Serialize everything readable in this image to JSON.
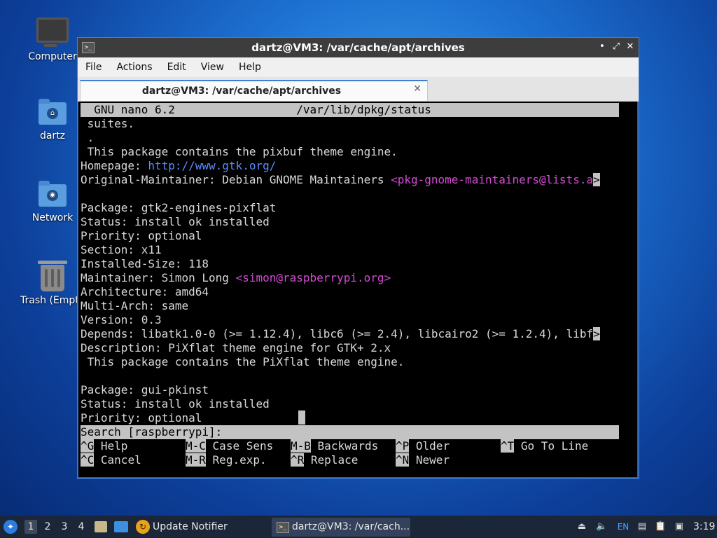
{
  "desktop": {
    "icons": [
      {
        "label": "Computer",
        "icon": "computer-icon"
      },
      {
        "label": "dartz",
        "icon": "home-folder-icon"
      },
      {
        "label": "Network",
        "icon": "network-folder-icon"
      },
      {
        "label": "Trash (Empt",
        "icon": "trash-icon"
      }
    ]
  },
  "window": {
    "title": "dartz@VM3: /var/cache/apt/archives",
    "controls": {
      "minimize": "•",
      "maximize": "⤢",
      "close": "✕"
    },
    "menu": [
      "File",
      "Actions",
      "Edit",
      "View",
      "Help"
    ],
    "tab": {
      "label": "dartz@VM3: /var/cache/apt/archives",
      "close": "✕"
    }
  },
  "nano": {
    "version": "GNU nano 6.2",
    "filename": "/var/lib/dpkg/status",
    "lines": [
      " suites.",
      " .",
      " This package contains the pixbuf theme engine.",
      "Homepage: ",
      "Original-Maintainer: Debian GNOME Maintainers ",
      "",
      "Package: gtk2-engines-pixflat",
      "Status: install ok installed",
      "Priority: optional",
      "Section: x11",
      "Installed-Size: 118",
      "Maintainer: Simon Long ",
      "Architecture: amd64",
      "Multi-Arch: same",
      "Version: 0.3",
      "Depends: libatk1.0-0 (>= 1.12.4), libc6 (>= 2.4), libcairo2 (>= 1.2.4), libf",
      "Description: PiXflat theme engine for GTK+ 2.x",
      " This package contains the PiXflat theme engine.",
      "",
      "Package: gui-pkinst",
      "Status: install ok installed",
      "Priority: optional"
    ],
    "homepage_url": "http://www.gtk.org/",
    "orig_maintainer_email": "<pkg-gnome-maintainers@lists.a",
    "maintainer_email": "<simon@raspberrypi.org>",
    "overflow_marker": ">",
    "search_prompt": "Search [raspberrypi]: ",
    "shortcuts_row1": [
      {
        "key": "^G",
        "label": "Help"
      },
      {
        "key": "M-C",
        "label": "Case Sens"
      },
      {
        "key": "M-B",
        "label": "Backwards"
      },
      {
        "key": "^P",
        "label": "Older"
      },
      {
        "key": "^T",
        "label": "Go To Line"
      }
    ],
    "shortcuts_row2": [
      {
        "key": "^C",
        "label": "Cancel"
      },
      {
        "key": "M-R",
        "label": "Reg.exp."
      },
      {
        "key": "^R",
        "label": "Replace"
      },
      {
        "key": "^N",
        "label": "Newer"
      }
    ]
  },
  "taskbar": {
    "workspaces": [
      "1",
      "2",
      "3",
      "4"
    ],
    "update_notifier": "Update Notifier",
    "task": "dartz@VM3: /var/cach...",
    "language": "EN",
    "clock": "3:19"
  },
  "colors": {
    "link": "#5b8cff",
    "email": "#d24bd2",
    "accent": "#3f7ed6"
  }
}
